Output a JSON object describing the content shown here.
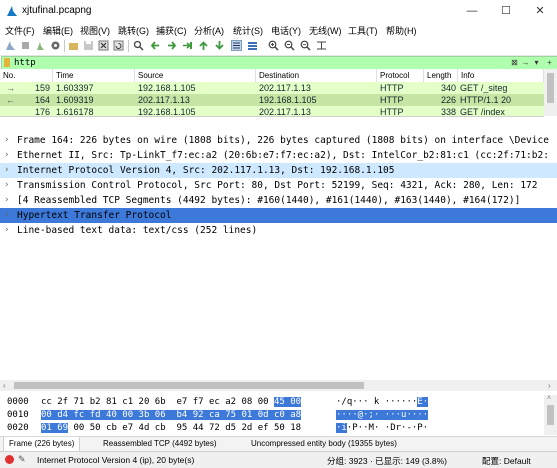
{
  "window": {
    "title": "xjtufinal.pcapng",
    "minimize": "—",
    "maximize": "☐",
    "close": "✕"
  },
  "menu": [
    "文件(F)",
    "编辑(E)",
    "视图(V)",
    "跳转(G)",
    "捕获(C)",
    "分析(A)",
    "统计(S)",
    "电话(Y)",
    "无线(W)",
    "工具(T)",
    "帮助(H)"
  ],
  "toolbar_icons": [
    "shark-fin-start-icon",
    "stop-capture-icon",
    "restart-capture-icon",
    "capture-options-icon",
    "open-file-icon",
    "save-file-icon",
    "close-file-icon",
    "reload-file-icon",
    "find-packet-icon",
    "go-back-icon",
    "go-forward-icon",
    "go-to-packet-icon",
    "go-first-icon",
    "go-last-icon",
    "autoscroll-icon",
    "colorize-icon",
    "zoom-in-icon",
    "zoom-out-icon",
    "zoom-normal-icon",
    "resize-columns-icon"
  ],
  "filter": {
    "value": "http"
  },
  "columns": [
    "No.",
    "Time",
    "Source",
    "Destination",
    "Protocol",
    "Length",
    "Info"
  ],
  "packets": [
    {
      "no": "159",
      "time": "1.603397",
      "src": "192.168.1.105",
      "dst": "202.117.1.13",
      "proto": "HTTP",
      "len": "340",
      "info": "GET /_siteg",
      "bg": "#e4ffc7",
      "fg": "#12272e",
      "marker": "→"
    },
    {
      "no": "164",
      "time": "1.609319",
      "src": "202.117.1.13",
      "dst": "192.168.1.105",
      "proto": "HTTP",
      "len": "226",
      "info": "HTTP/1.1 20",
      "bg": "#c5e5a5",
      "fg": "#12272e",
      "marker": "←"
    },
    {
      "no": "176",
      "time": "1.616178",
      "src": "192.168.1.105",
      "dst": "202.117.1.13",
      "proto": "HTTP",
      "len": "338",
      "info": "GET /index",
      "bg": "#e4ffc7",
      "fg": "#12272e",
      "marker": ""
    }
  ],
  "details": [
    {
      "text": "Frame 164: 226 bytes on wire (1808 bits), 226 bytes captured (1808 bits) on interface \\Device",
      "arrow": "›",
      "bg": "#ffffff",
      "fg": "#000000"
    },
    {
      "text": "Ethernet II, Src: Tp-LinkT_f7:ec:a2 (20:6b:e7:f7:ec:a2), Dst: IntelCor_b2:81:c1 (cc:2f:71:b2:",
      "arrow": "›",
      "bg": "#ffffff",
      "fg": "#000000"
    },
    {
      "text": "Internet Protocol Version 4, Src: 202.117.1.13, Dst: 192.168.1.105",
      "arrow": "›",
      "bg": "#cde8ff",
      "fg": "#000000"
    },
    {
      "text": "Transmission Control Protocol, Src Port: 80, Dst Port: 52199, Seq: 4321, Ack: 280, Len: 172",
      "arrow": "›",
      "bg": "#ffffff",
      "fg": "#000000"
    },
    {
      "text": "[4 Reassembled TCP Segments (4492 bytes): #160(1440), #161(1440), #163(1440), #164(172)]",
      "arrow": "›",
      "bg": "#ffffff",
      "fg": "#000000"
    },
    {
      "text": "Hypertext Transfer Protocol",
      "arrow": "›",
      "bg": "#3c79d9",
      "fg": "#000000"
    },
    {
      "text": "Line-based text data: text/css (252 lines)",
      "arrow": "›",
      "bg": "#ffffff",
      "fg": "#000000"
    }
  ],
  "hex": [
    {
      "offset": "0000",
      "plain": "cc 2f 71 b2 81 c1 20 6b  e7 f7 ec a2 08 00 ",
      "sel": "45 00",
      "ascii_plain": "·/q··· k ······",
      "ascii_sel": "E·"
    },
    {
      "offset": "0010",
      "sel": "00 d4 fc fd 40 00 3b 06  b4 92 ca 75 01 0d c0 a8",
      "ascii_sel": "····@·;· ···u····"
    },
    {
      "offset": "0020",
      "sel": "01 69",
      "plain": " 00 50 cb e7 4d cb  95 44 72 d5 2d ef 50 18",
      "ascii_sel": "·i",
      "ascii_plain": "·P··M· ·Dr·-·P·"
    }
  ],
  "byte_tabs": [
    "Frame (226 bytes)",
    "Reassembled TCP (4492 bytes)",
    "Uncompressed entity body (19355 bytes)"
  ],
  "status": {
    "left": "Internet Protocol Version 4 (ip), 20 byte(s)",
    "packets": "分组: 3923 · 已显示: 149 (3.8%)",
    "profile": "配置: Default"
  }
}
